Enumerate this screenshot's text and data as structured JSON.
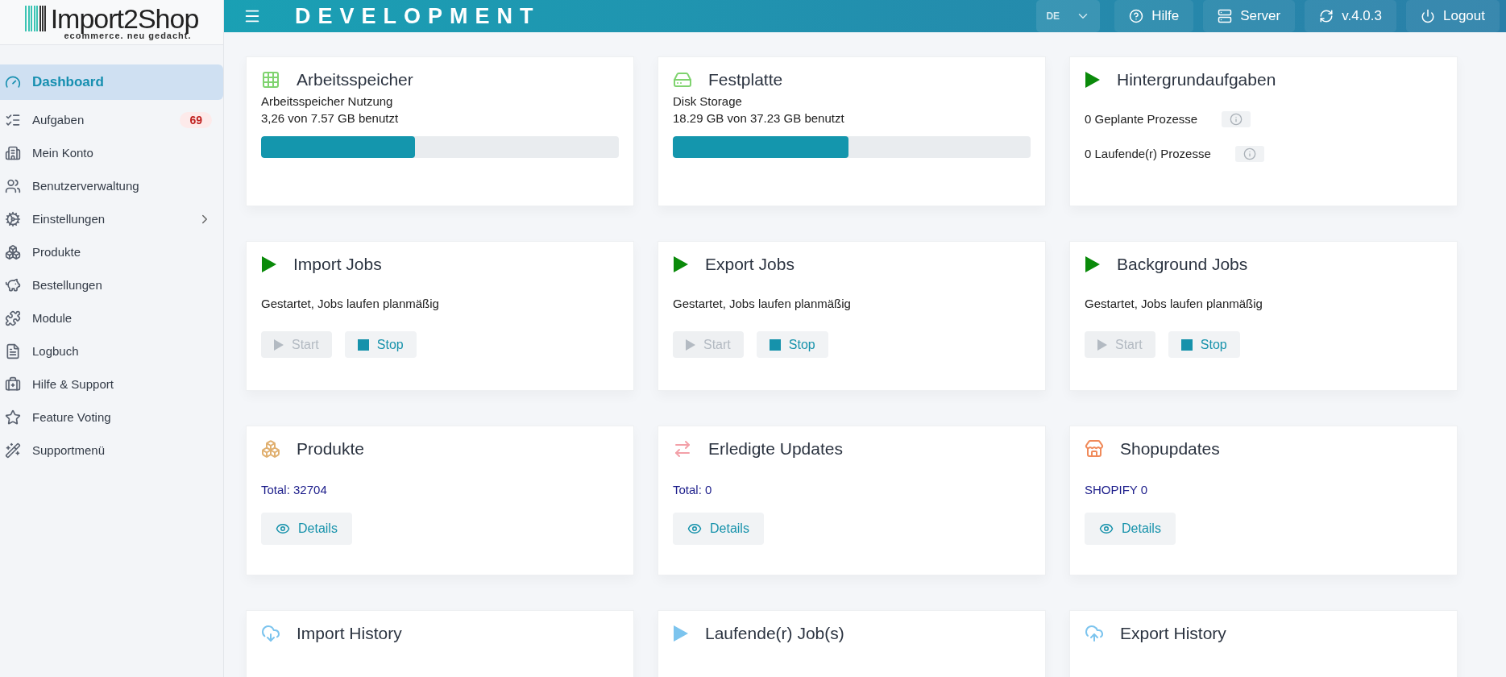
{
  "logo": {
    "name": "Import2Shop",
    "tagline": "ecommerce. neu gedacht."
  },
  "header": {
    "environment": "DEVELOPMENT",
    "language": "DE",
    "buttons": [
      {
        "label": "Hilfe"
      },
      {
        "label": "Server"
      },
      {
        "label": "v.4.0.3"
      },
      {
        "label": "Logout"
      }
    ]
  },
  "sidebar": {
    "items": [
      {
        "label": "Dashboard",
        "selected": true,
        "has_submenu": false
      },
      {
        "label": "Aufgaben",
        "selected": false,
        "has_submenu": false,
        "badge": "69"
      },
      {
        "label": "Mein Konto",
        "selected": false,
        "has_submenu": false
      },
      {
        "label": "Benutzerverwaltung",
        "selected": false,
        "has_submenu": false
      },
      {
        "label": "Einstellungen",
        "selected": false,
        "has_submenu": true
      },
      {
        "label": "Produkte",
        "selected": false,
        "has_submenu": false
      },
      {
        "label": "Bestellungen",
        "selected": false,
        "has_submenu": false
      },
      {
        "label": "Module",
        "selected": false,
        "has_submenu": false
      },
      {
        "label": "Logbuch",
        "selected": false,
        "has_submenu": false
      },
      {
        "label": "Hilfe & Support",
        "selected": false,
        "has_submenu": false
      },
      {
        "label": "Feature Voting",
        "selected": false,
        "has_submenu": false
      },
      {
        "label": "Supportmenü",
        "selected": false,
        "has_submenu": false
      }
    ]
  },
  "cards": [
    {
      "kind": "meter",
      "title": "Arbeitsspeicher",
      "subtitle": "Arbeitsspeicher Nutzung",
      "reading": "3,26 von 7.57 GB benutzt",
      "level": 0.43
    },
    {
      "kind": "meter",
      "title": "Festplatte",
      "subtitle": "Disk Storage",
      "reading": "18.29 GB von 37.23 GB benutzt",
      "level": 0.49
    },
    {
      "kind": "processes",
      "title": "Hintergrundaufgaben",
      "rows": [
        "0 Geplante Prozesse",
        "0 Laufende(r) Prozesse"
      ]
    },
    {
      "kind": "jobs",
      "title": "Import Jobs",
      "status": "Gestartet, Jobs laufen planmäßig",
      "buttons": [
        {
          "label": "Start",
          "disabled": true
        },
        {
          "label": "Stop",
          "disabled": false
        }
      ]
    },
    {
      "kind": "jobs",
      "title": "Export Jobs",
      "status": "Gestartet, Jobs laufen planmäßig",
      "buttons": [
        {
          "label": "Start",
          "disabled": true
        },
        {
          "label": "Stop",
          "disabled": false
        }
      ]
    },
    {
      "kind": "jobs",
      "title": "Background Jobs",
      "status": "Gestartet, Jobs laufen planmäßig",
      "buttons": [
        {
          "label": "Start",
          "disabled": true
        },
        {
          "label": "Stop",
          "disabled": false
        }
      ]
    },
    {
      "kind": "stat",
      "title": "Produkte",
      "value": "Total: 32704",
      "button": "Details"
    },
    {
      "kind": "stat",
      "title": "Erledigte Updates",
      "value": "Total: 0",
      "button": "Details"
    },
    {
      "kind": "stat",
      "title": "Shopupdates",
      "value": "SHOPIFY 0",
      "button": "Details"
    },
    {
      "kind": "header",
      "title": "Import History"
    },
    {
      "kind": "header",
      "title": "Laufende(r) Job(s)"
    },
    {
      "kind": "header",
      "title": "Export History"
    }
  ]
}
